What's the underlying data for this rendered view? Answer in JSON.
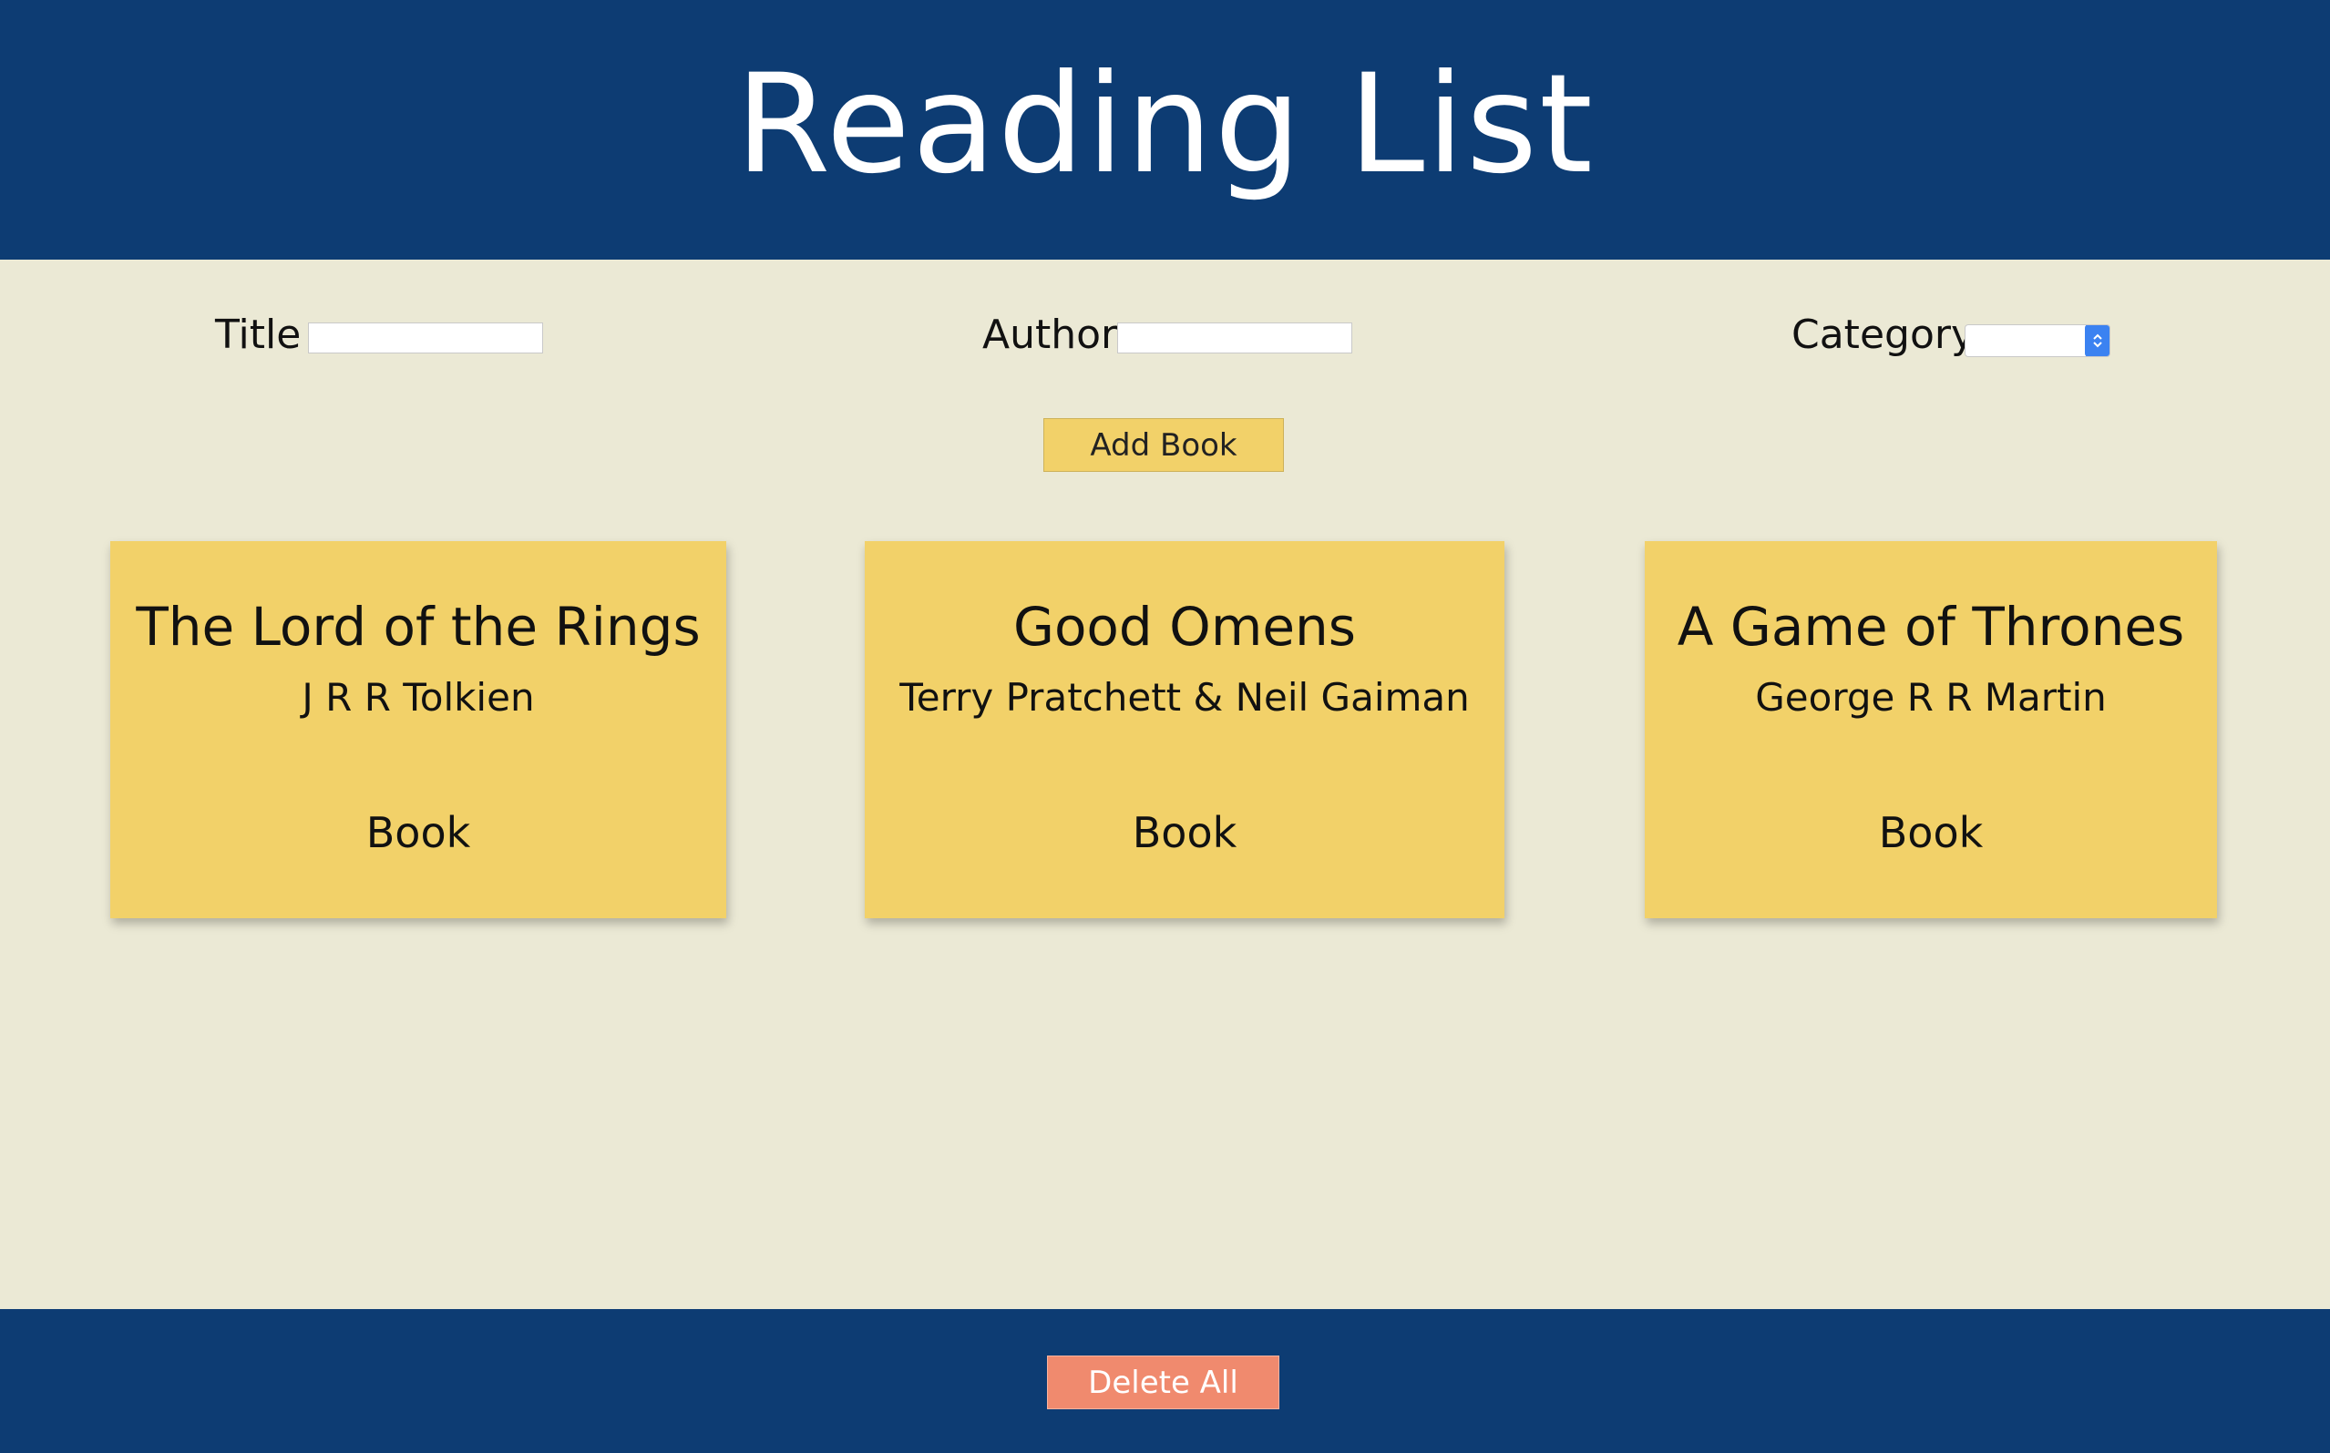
{
  "header": {
    "title": "Reading List"
  },
  "form": {
    "title_label": "Title",
    "title_value": "",
    "author_label": "Author",
    "author_value": "",
    "category_label": "Category",
    "category_selected": "",
    "add_button_label": "Add Book"
  },
  "books": [
    {
      "title": "The Lord of the Rings",
      "author": "J R R Tolkien",
      "category": "Book"
    },
    {
      "title": "Good Omens",
      "author": "Terry Pratchett & Neil Gaiman",
      "category": "Book"
    },
    {
      "title": "A Game of Thrones",
      "author": "George R R Martin",
      "category": "Book"
    }
  ],
  "footer": {
    "delete_all_label": "Delete All"
  },
  "colors": {
    "header_background": "#0d3c73",
    "page_background": "#ebe9d5",
    "card_background": "#f2d169",
    "delete_button": "#f08a6e",
    "select_accent": "#3b82f1"
  },
  "icons": {
    "select_arrow": "chevron-up-down-icon"
  }
}
